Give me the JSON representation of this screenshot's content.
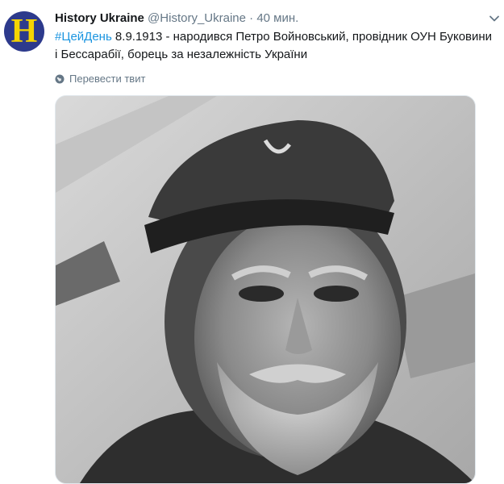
{
  "tweet": {
    "display_name": "History Ukraine",
    "handle": "@History_Ukraine",
    "separator": "·",
    "time": "40 мин.",
    "avatar_letter": "H",
    "hashtag": "#ЦейДень",
    "text_line1": " 8.9.1913 - народився Петро Войновський, провідник ОУН Буковини",
    "text_line2": "і Бессарабії, борець за незалежність України",
    "translate_label": "Перевести твит"
  },
  "colors": {
    "link": "#1b95e0",
    "secondary_text": "#657786",
    "avatar_bg": "#2d3a8c",
    "avatar_letter": "#f5d400"
  },
  "icons": {
    "more": "chevron-down-icon",
    "translate": "globe-icon"
  }
}
